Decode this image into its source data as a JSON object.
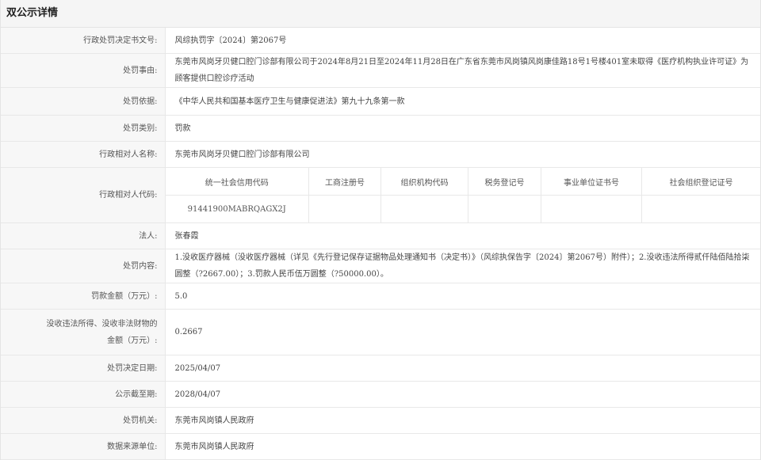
{
  "header": {
    "title": "双公示详情"
  },
  "rows": {
    "doc_no": {
      "label": "行政处罚决定书文号:",
      "value": "风综执罚字〔2024〕第2067号"
    },
    "reason": {
      "label": "处罚事由:",
      "value": "东莞市风岗牙贝健口腔门诊部有限公司于2024年8月21日至2024年11月28日在广东省东莞市风岗镇风岗康佳路18号1号楼401室未取得《医疗机构执业许可证》为顾客提供口腔诊疗活动"
    },
    "basis": {
      "label": "处罚依据:",
      "value": "《中华人民共和国基本医疗卫生与健康促进法》第九十九条第一款"
    },
    "category": {
      "label": "处罚类别:",
      "value": "罚款"
    },
    "party_name": {
      "label": "行政相对人名称:",
      "value": "东莞市风岗牙贝健口腔门诊部有限公司"
    },
    "party_code": {
      "label": "行政相对人代码:",
      "headers": [
        "统一社会信用代码",
        "工商注册号",
        "组织机构代码",
        "税务登记号",
        "事业单位证书号",
        "社会组织登记证号"
      ],
      "values": [
        "91441900MABRQAGX2J",
        "",
        "",
        "",
        "",
        ""
      ]
    },
    "legal_rep": {
      "label": "法人:",
      "value": "张春霞"
    },
    "content": {
      "label": "处罚内容:",
      "value": "1.没收医疗器械（没收医疗器械（详见《先行登记保存证据物品处理通知书（决定书）》（风综执保告字〔2024〕第2067号）附件）；2.没收违法所得贰仟陆佰陆拾柒圆整（?2667.00）；3.罚款人民币伍万圆整（?50000.00）。"
    },
    "fine": {
      "label": "罚款金额（万元）:",
      "value": "5.0"
    },
    "confiscation": {
      "label_line1": "没收违法所得、没收非法财物的",
      "label_line2": "金额（万元）:",
      "value": "0.2667"
    },
    "decision_date": {
      "label": "处罚决定日期:",
      "value": "2025/04/07"
    },
    "publicity_deadline": {
      "label": "公示截至期:",
      "value": "2028/04/07"
    },
    "authority": {
      "label": "处罚机关:",
      "value": "东莞市风岗镇人民政府"
    },
    "source": {
      "label": "数据来源单位:",
      "value": "东莞市风岗镇人民政府"
    }
  }
}
